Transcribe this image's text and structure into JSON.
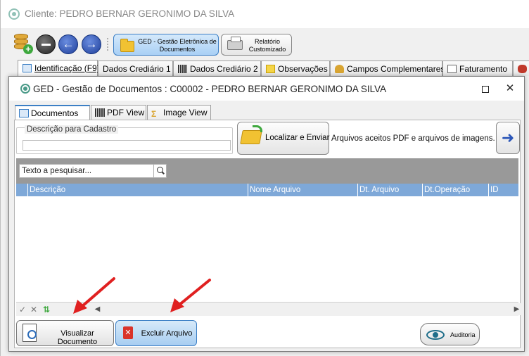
{
  "outer_window": {
    "title": "Cliente: PEDRO BERNAR GERONIMO DA SILVA"
  },
  "toolbar": {
    "ged_label": "GED - Gestão Eletrônica de Documentos",
    "relatorio_label": "Relatório Customizado",
    "icons": [
      "database-add-icon",
      "minus-circle-icon",
      "arrow-left-icon",
      "arrow-right-icon",
      "folder-icon",
      "printer-icon"
    ]
  },
  "outer_tabs": [
    {
      "label": "Identificação (F9)",
      "mnemonic_underlined": "I"
    },
    {
      "label": "Dados Crediário 1"
    },
    {
      "label": "Dados Crediário 2"
    },
    {
      "label": "Observações"
    },
    {
      "label": "Campos Complementares"
    },
    {
      "label": "Faturamento"
    }
  ],
  "inner_window": {
    "title": "GED - Gestão de Documentos : C00002 - PEDRO BERNAR GERONIMO DA SILVA",
    "maximize_label": "",
    "close_label": "✕"
  },
  "inner_tabs": [
    {
      "label": "Documentos"
    },
    {
      "label": "PDF View"
    },
    {
      "label": "Image View"
    }
  ],
  "cadastro": {
    "group_label": "Descrição para Cadastro",
    "value": ""
  },
  "localizar": {
    "label": "Localizar e Enviar"
  },
  "aceitos_text": "Arquivos aceitos PDF e arquivos de imagens.",
  "next_label": "➜",
  "search": {
    "value": "Texto a pesquisar..."
  },
  "grid": {
    "columns": [
      "Descrição",
      "Nome Arquivo",
      "Dt. Arquivo",
      "Dt.Operação",
      "ID"
    ],
    "rows": []
  },
  "nav": {
    "confirm": "✓",
    "cancel": "✕",
    "sort": "⇅"
  },
  "buttons": {
    "visualizar": "Visualizar Documento",
    "excluir": "Excluir Arquivo",
    "auditoria": "Auditoria"
  },
  "colors": {
    "grid_header": "#7ea8d8",
    "active_button": "#a7cdf1",
    "annotation_arrow": "#e02020"
  }
}
